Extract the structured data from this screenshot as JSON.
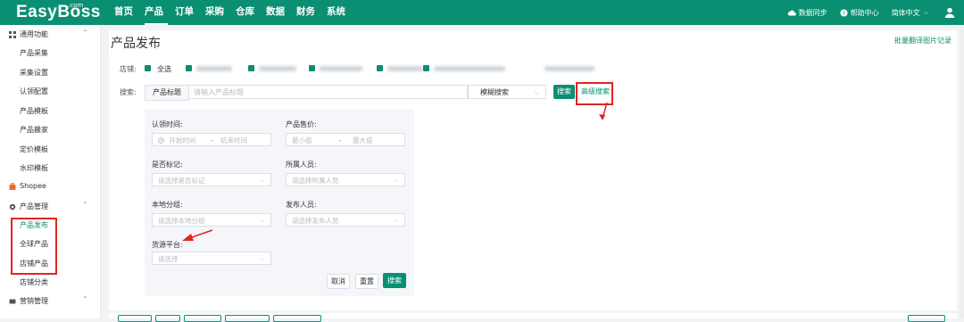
{
  "brand": {
    "name": "EasyBoss",
    "suffix": ".com"
  },
  "nav": [
    "首页",
    "产品",
    "订单",
    "采购",
    "仓库",
    "数据",
    "财务",
    "系统"
  ],
  "topright": {
    "sync": "数据同步",
    "help": "帮助中心",
    "lang": "简体中文"
  },
  "sidebar": {
    "group_common": "通用功能",
    "common_items": [
      "产品采集",
      "采集设置",
      "认领配置",
      "产品模板",
      "产品搬家",
      "定价模板",
      "水印模板"
    ],
    "shopee": "Shopee",
    "group_product": "产品管理",
    "product_items": [
      "产品发布",
      "全球产品",
      "店铺产品",
      "店铺分类"
    ],
    "group_marketing": "营销管理"
  },
  "main": {
    "title": "产品发布",
    "top_link": "批量翻译图片记录",
    "store_label": "店铺:",
    "select_all": "全选",
    "search_label": "搜索:",
    "search_field": "产品标题",
    "search_placeholder": "请输入产品标题",
    "mode": "模糊搜索",
    "search_btn": "搜索",
    "advanced": "高级搜索"
  },
  "panel": {
    "claim_time": "认领时间:",
    "start_time": "开始时间",
    "end_time": "结束时间",
    "price": "产品售价:",
    "min": "最小值",
    "max": "最大值",
    "marked": "是否标记:",
    "marked_ph": "请选择是否标记",
    "owner": "所属人员:",
    "owner_ph": "请选择所属人员",
    "local_group": "本地分组:",
    "local_group_ph": "请选择本地分组",
    "publisher": "发布人员:",
    "publisher_ph": "请选择发布人员",
    "source": "货源平台:",
    "source_ph": "请选择",
    "cancel": "取消",
    "reset": "重置",
    "search": "搜索"
  },
  "colors": {
    "primary": "#0b8f72",
    "highlight": "#e02424"
  }
}
